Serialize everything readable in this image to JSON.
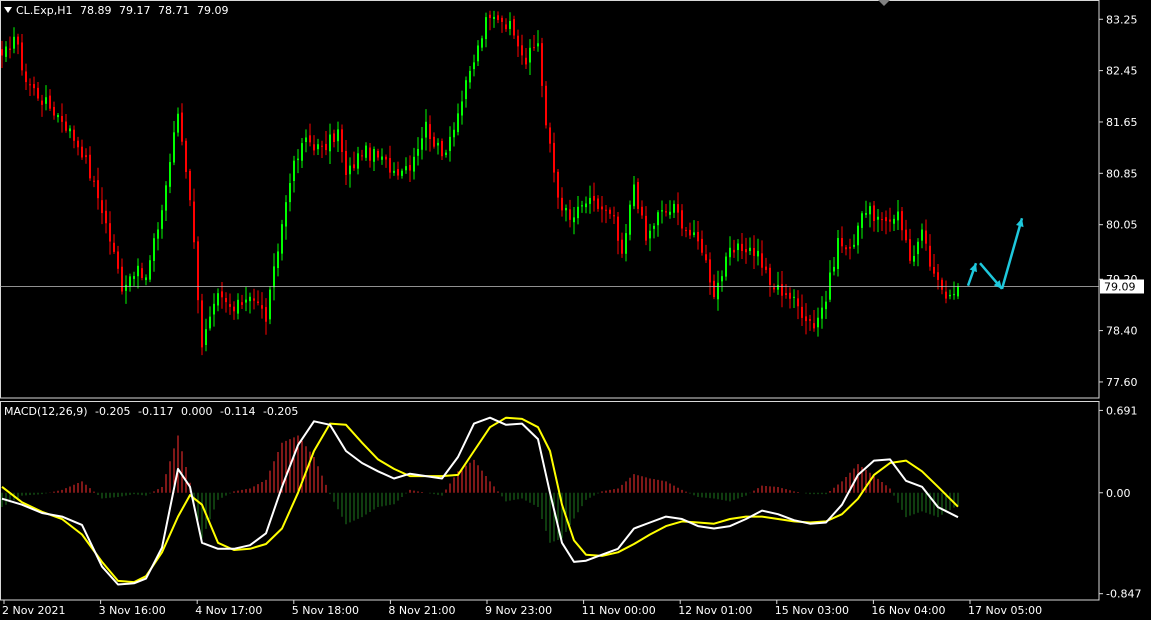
{
  "header": {
    "symbol": "CL.Exp,H1",
    "open": "78.89",
    "high": "79.17",
    "low": "78.71",
    "close": "79.09"
  },
  "macd_header": {
    "name": "MACD(12,26,9)",
    "values": [
      "-0.205",
      "-0.117",
      "0.000",
      "-0.114",
      "-0.205"
    ]
  },
  "colors": {
    "background": "#000000",
    "bull": "#00ff00",
    "bear": "#ff0000",
    "histogram_pos": "#ff3030",
    "histogram_neg": "#1e7a1e",
    "macd_line": "#ffffff",
    "signal_line": "#ffff00",
    "arrows": "#1ec8dc",
    "current_price_line": "#c0c0c0"
  },
  "chart_data": [
    {
      "type": "candlestick",
      "symbol": "CL.Exp,H1",
      "current_price": 79.09,
      "ylim": [
        77.35,
        83.55
      ],
      "y_ticks": [
        "83.25",
        "82.45",
        "81.65",
        "80.85",
        "80.05",
        "79.20",
        "78.40",
        "77.60"
      ],
      "x_ticks": [
        "2 Nov 2021",
        "3 Nov 16:00",
        "4 Nov 17:00",
        "5 Nov 18:00",
        "8 Nov 21:00",
        "9 Nov 23:00",
        "11 Nov 00:00",
        "12 Nov 01:00",
        "15 Nov 03:00",
        "16 Nov 04:00",
        "17 Nov 05:00"
      ],
      "close_anchors": [
        [
          0,
          82.6
        ],
        [
          3,
          83.0
        ],
        [
          6,
          82.3
        ],
        [
          10,
          82.0
        ],
        [
          15,
          81.7
        ],
        [
          20,
          81.2
        ],
        [
          25,
          80.3
        ],
        [
          30,
          79.1
        ],
        [
          33,
          79.35
        ],
        [
          36,
          79.2
        ],
        [
          40,
          80.3
        ],
        [
          44,
          81.8
        ],
        [
          47,
          80.5
        ],
        [
          50,
          78.2
        ],
        [
          54,
          78.9
        ],
        [
          58,
          78.7
        ],
        [
          62,
          79.0
        ],
        [
          66,
          78.6
        ],
        [
          68,
          79.3
        ],
        [
          72,
          80.8
        ],
        [
          76,
          81.4
        ],
        [
          80,
          81.2
        ],
        [
          84,
          81.5
        ],
        [
          86,
          80.8
        ],
        [
          90,
          81.2
        ],
        [
          94,
          81.1
        ],
        [
          98,
          80.9
        ],
        [
          102,
          81.0
        ],
        [
          106,
          81.6
        ],
        [
          110,
          81.1
        ],
        [
          114,
          81.8
        ],
        [
          118,
          82.6
        ],
        [
          121,
          83.2
        ],
        [
          124,
          83.3
        ],
        [
          128,
          83.1
        ],
        [
          131,
          82.6
        ],
        [
          134,
          82.9
        ],
        [
          136,
          81.6
        ],
        [
          139,
          80.5
        ],
        [
          142,
          80.1
        ],
        [
          146,
          80.4
        ],
        [
          150,
          80.3
        ],
        [
          153,
          80.1
        ],
        [
          155,
          79.5
        ],
        [
          158,
          80.7
        ],
        [
          161,
          79.8
        ],
        [
          164,
          80.2
        ],
        [
          168,
          80.3
        ],
        [
          172,
          79.9
        ],
        [
          175,
          79.7
        ],
        [
          178,
          79.0
        ],
        [
          182,
          79.6
        ],
        [
          186,
          79.7
        ],
        [
          189,
          79.6
        ],
        [
          192,
          79.1
        ],
        [
          196,
          79.0
        ],
        [
          200,
          78.7
        ],
        [
          203,
          78.5
        ],
        [
          206,
          78.9
        ],
        [
          209,
          79.8
        ],
        [
          212,
          79.6
        ],
        [
          215,
          80.3
        ],
        [
          218,
          80.2
        ],
        [
          221,
          80.0
        ],
        [
          224,
          80.3
        ],
        [
          227,
          79.5
        ],
        [
          230,
          79.9
        ],
        [
          233,
          79.2
        ],
        [
          236,
          79.0
        ],
        [
          239,
          79.09
        ]
      ]
    },
    {
      "type": "line+histogram",
      "title": "MACD(12,26,9)",
      "ylim": [
        -0.9,
        0.77
      ],
      "y_ticks": [
        "0.691",
        "0.00",
        "-0.847"
      ],
      "series": [
        {
          "name": "MACD",
          "points": [
            [
              0,
              -0.05
            ],
            [
              5,
              -0.1
            ],
            [
              10,
              -0.17
            ],
            [
              15,
              -0.2
            ],
            [
              20,
              -0.27
            ],
            [
              25,
              -0.62
            ],
            [
              29,
              -0.77
            ],
            [
              33,
              -0.76
            ],
            [
              36,
              -0.72
            ],
            [
              40,
              -0.46
            ],
            [
              44,
              0.2
            ],
            [
              47,
              0.05
            ],
            [
              50,
              -0.42
            ],
            [
              54,
              -0.47
            ],
            [
              58,
              -0.47
            ],
            [
              62,
              -0.44
            ],
            [
              66,
              -0.34
            ],
            [
              70,
              0.05
            ],
            [
              74,
              0.4
            ],
            [
              78,
              0.6
            ],
            [
              82,
              0.57
            ],
            [
              86,
              0.35
            ],
            [
              90,
              0.25
            ],
            [
              94,
              0.18
            ],
            [
              98,
              0.12
            ],
            [
              102,
              0.16
            ],
            [
              106,
              0.14
            ],
            [
              110,
              0.12
            ],
            [
              114,
              0.3
            ],
            [
              118,
              0.58
            ],
            [
              122,
              0.63
            ],
            [
              126,
              0.57
            ],
            [
              130,
              0.58
            ],
            [
              134,
              0.45
            ],
            [
              137,
              0.0
            ],
            [
              140,
              -0.42
            ],
            [
              143,
              -0.58
            ],
            [
              146,
              -0.57
            ],
            [
              150,
              -0.52
            ],
            [
              154,
              -0.47
            ],
            [
              158,
              -0.3
            ],
            [
              162,
              -0.25
            ],
            [
              166,
              -0.2
            ],
            [
              170,
              -0.22
            ],
            [
              174,
              -0.28
            ],
            [
              178,
              -0.3
            ],
            [
              182,
              -0.28
            ],
            [
              186,
              -0.22
            ],
            [
              190,
              -0.15
            ],
            [
              194,
              -0.18
            ],
            [
              198,
              -0.23
            ],
            [
              202,
              -0.26
            ],
            [
              206,
              -0.25
            ],
            [
              210,
              -0.1
            ],
            [
              214,
              0.15
            ],
            [
              218,
              0.27
            ],
            [
              222,
              0.28
            ],
            [
              226,
              0.1
            ],
            [
              230,
              0.05
            ],
            [
              234,
              -0.12
            ],
            [
              239,
              -0.205
            ]
          ]
        },
        {
          "name": "Signal",
          "points": [
            [
              0,
              0.05
            ],
            [
              5,
              -0.08
            ],
            [
              10,
              -0.16
            ],
            [
              15,
              -0.22
            ],
            [
              20,
              -0.35
            ],
            [
              25,
              -0.58
            ],
            [
              29,
              -0.74
            ],
            [
              33,
              -0.75
            ],
            [
              36,
              -0.7
            ],
            [
              40,
              -0.5
            ],
            [
              44,
              -0.2
            ],
            [
              47,
              -0.02
            ],
            [
              50,
              -0.1
            ],
            [
              54,
              -0.42
            ],
            [
              58,
              -0.48
            ],
            [
              62,
              -0.47
            ],
            [
              66,
              -0.43
            ],
            [
              70,
              -0.3
            ],
            [
              74,
              0.0
            ],
            [
              78,
              0.35
            ],
            [
              82,
              0.58
            ],
            [
              86,
              0.57
            ],
            [
              90,
              0.42
            ],
            [
              94,
              0.28
            ],
            [
              98,
              0.2
            ],
            [
              102,
              0.14
            ],
            [
              106,
              0.14
            ],
            [
              110,
              0.14
            ],
            [
              114,
              0.15
            ],
            [
              118,
              0.35
            ],
            [
              122,
              0.55
            ],
            [
              126,
              0.63
            ],
            [
              130,
              0.62
            ],
            [
              134,
              0.55
            ],
            [
              137,
              0.35
            ],
            [
              140,
              -0.1
            ],
            [
              143,
              -0.4
            ],
            [
              146,
              -0.52
            ],
            [
              150,
              -0.53
            ],
            [
              154,
              -0.5
            ],
            [
              158,
              -0.43
            ],
            [
              162,
              -0.35
            ],
            [
              166,
              -0.28
            ],
            [
              170,
              -0.24
            ],
            [
              174,
              -0.25
            ],
            [
              178,
              -0.26
            ],
            [
              182,
              -0.22
            ],
            [
              186,
              -0.2
            ],
            [
              190,
              -0.2
            ],
            [
              194,
              -0.22
            ],
            [
              198,
              -0.24
            ],
            [
              202,
              -0.25
            ],
            [
              206,
              -0.24
            ],
            [
              210,
              -0.18
            ],
            [
              214,
              -0.05
            ],
            [
              218,
              0.15
            ],
            [
              222,
              0.25
            ],
            [
              226,
              0.27
            ],
            [
              230,
              0.18
            ],
            [
              234,
              0.05
            ],
            [
              239,
              -0.117
            ]
          ]
        }
      ]
    }
  ]
}
